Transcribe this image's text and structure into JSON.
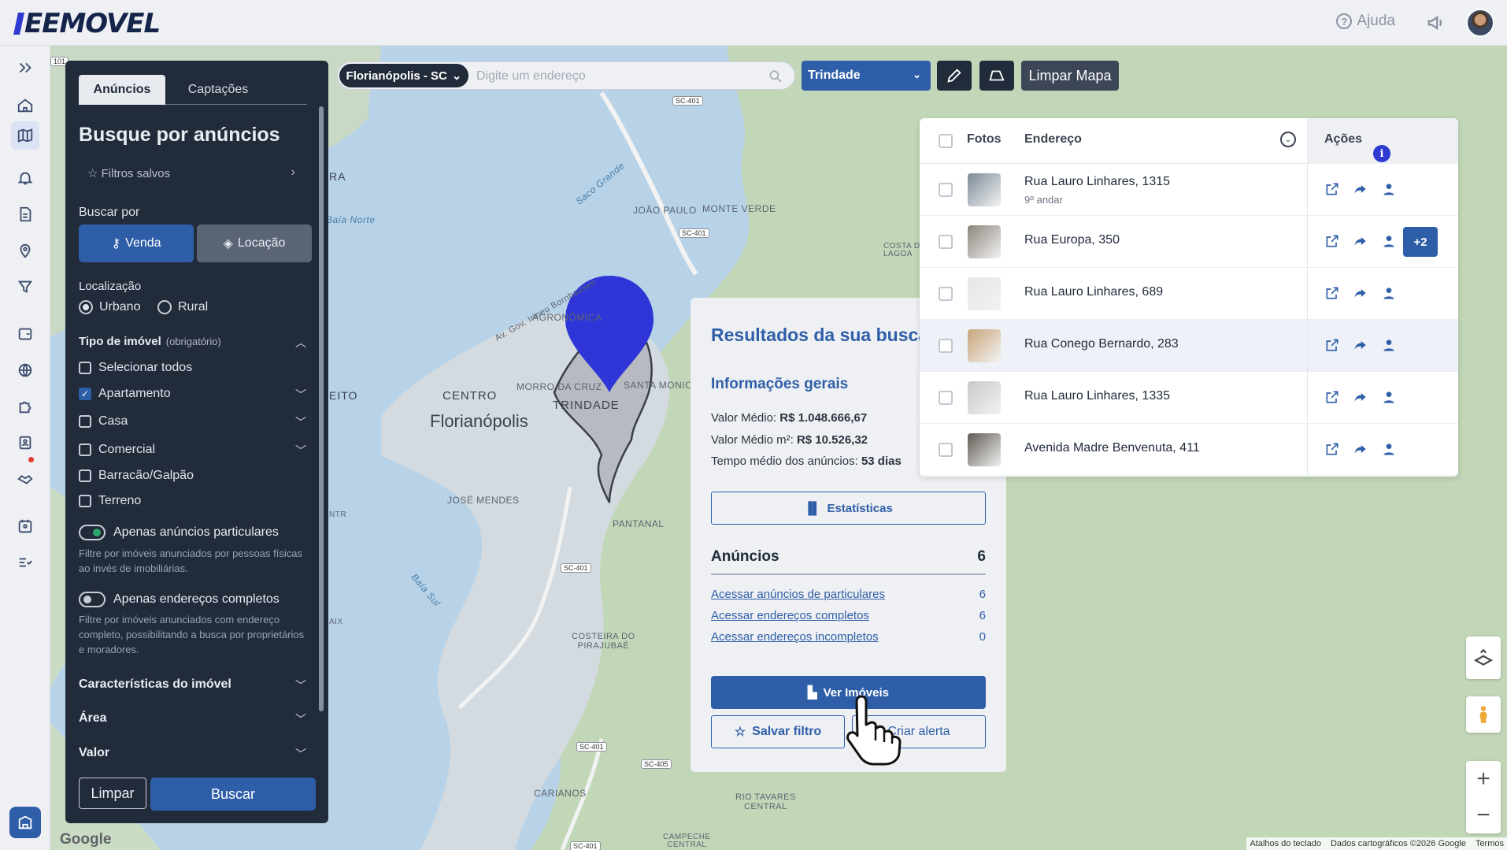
{
  "app": {
    "logo_text": "EEMOVEL",
    "help_label": "Ajuda"
  },
  "panel": {
    "tabs": [
      "Anúncios",
      "Captações"
    ],
    "title": "Busque por anúncios",
    "saved_filters": "Filtros salvos",
    "search_by_label": "Buscar por",
    "mode_sale": "Venda",
    "mode_rent": "Locação",
    "location_label": "Localização",
    "location_options": [
      "Urbano",
      "Rural"
    ],
    "property_type_label": "Tipo de imóvel",
    "property_type_required": "(obrigatório)",
    "property_types": [
      {
        "label": "Selecionar todos",
        "checked": false
      },
      {
        "label": "Apartamento",
        "checked": true
      },
      {
        "label": "Casa",
        "checked": false
      },
      {
        "label": "Comercial",
        "checked": false
      },
      {
        "label": "Barracão/Galpão",
        "checked": false
      },
      {
        "label": "Terreno",
        "checked": false
      }
    ],
    "toggle_private": "Apenas anúncios particulares",
    "toggle_private_hint": "Filtre por imóveis anunciados por pessoas físicas ao invés de imobiliárias.",
    "toggle_full_address": "Apenas endereços completos",
    "toggle_full_address_hint": "Filtre por imóveis anunciados com endereço completo, possibilitando a busca por proprietários e moradores.",
    "sections": [
      "Características do imóvel",
      "Área",
      "Valor"
    ],
    "clear_label": "Limpar",
    "search_label": "Buscar"
  },
  "toolbar": {
    "city": "Florianópolis - SC",
    "address_placeholder": "Digite um endereço",
    "neighborhood": "Trindade",
    "clear_map": "Limpar Mapa"
  },
  "map": {
    "labels": {
      "florianopolis": "Florianópolis",
      "centro": "CENTRO",
      "trindade": "TRINDADE",
      "agronomica": "AGRONÔMICA",
      "morro_da_cruz": "MORRO DA CRUZ",
      "santa_monica": "SANTA MONICA",
      "joao_paulo": "JOÃO PAULO",
      "monte_verde": "MONTE VERDE",
      "costa_lagoa": "COSTA D\nLAGOA",
      "jose_mendes": "JOSÉ MENDES",
      "pantanal": "PANTANAL",
      "costeira": "COSTEIRA DO\nPIRAJUBAÉ",
      "carianos": "CARIANOS",
      "rio_tavares": "RIO TAVARES\nCENTRAL",
      "campeche": "CAMPECHE\nCENTRAL",
      "saco_grande": "Saco Grande",
      "baia_norte": "Baía Norte",
      "baia_sul": "Baía Sul",
      "beira_mar": "Av. Gov. Irineu Bornhausen",
      "eito": "EITO",
      "ra": "RA",
      "aix": "AIX",
      "ntr": "NTR"
    },
    "road_tags": [
      "SC-401",
      "SC-401",
      "SC-401",
      "SC-401",
      "SC-405",
      "SC-401",
      "101"
    ],
    "pin_color": "#2f35d6",
    "google": "Google",
    "attribution": [
      "Atalhos do teclado",
      "Dados cartográficos ©2026 Google",
      "Termos"
    ]
  },
  "results": {
    "title": "Resultados da sua busca",
    "general_info": "Informações gerais",
    "avg_value_label": "Valor Médio:",
    "avg_value": "R$ 1.048.666,67",
    "avg_m2_label": "Valor Médio m²:",
    "avg_m2": "R$ 10.526,32",
    "avg_time_label": "Tempo médio dos anúncios:",
    "avg_time": "53 dias",
    "stats_button": "Estatísticas",
    "listings_label": "Anúncios",
    "listings_count": "6",
    "links": [
      {
        "label": "Acessar anúncios de particulares",
        "count": "6"
      },
      {
        "label": "Acessar endereços completos",
        "count": "6"
      },
      {
        "label": "Acessar endereços incompletos",
        "count": "0"
      }
    ],
    "view_button": "Ver Imóveis",
    "save_filter_button": "Salvar filtro",
    "alert_button": "Criar alerta"
  },
  "table": {
    "headers": {
      "photos": "Fotos",
      "address": "Endereço",
      "actions": "Ações"
    },
    "rows": [
      {
        "address": "Rua Lauro Linhares, 1315",
        "sub": "9º andar",
        "thumb": "#7d8a99",
        "extra": ""
      },
      {
        "address": "Rua Europa, 350",
        "sub": "",
        "thumb": "#8c857c",
        "extra": "+2"
      },
      {
        "address": "Rua Lauro Linhares, 689",
        "sub": "",
        "thumb": "#e6e6e6",
        "extra": ""
      },
      {
        "address": "Rua Conego Bernardo, 283",
        "sub": "",
        "thumb": "#c7a57a",
        "extra": ""
      },
      {
        "address": "Rua Lauro Linhares, 1335",
        "sub": "",
        "thumb": "#c9c9c9",
        "extra": ""
      },
      {
        "address": "Avenida Madre Benvenuta, 411",
        "sub": "",
        "thumb": "#5f5a52",
        "extra": ""
      }
    ]
  },
  "colors": {
    "primary": "#2f5ea8",
    "panel_dark": "#212b3a",
    "pin": "#2f35d6"
  }
}
